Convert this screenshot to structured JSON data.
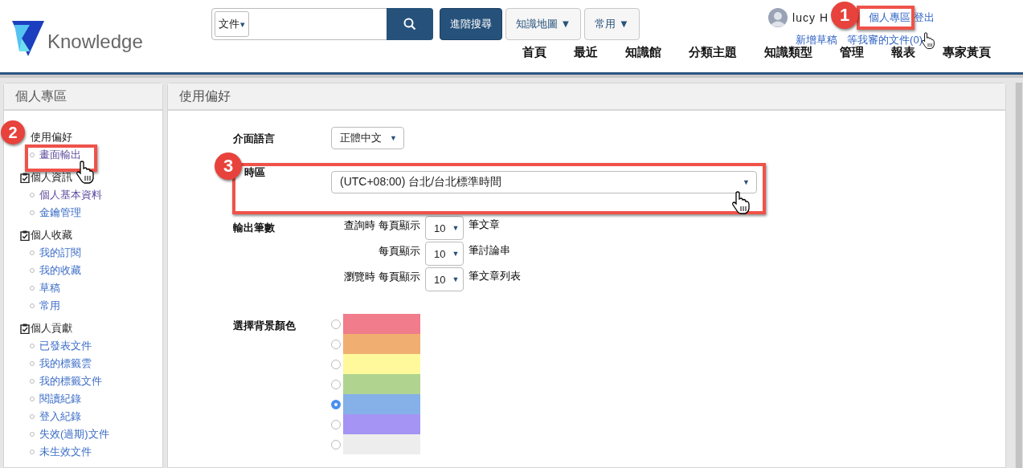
{
  "header": {
    "logo_text": "Knowledge",
    "search": {
      "scope": "文件",
      "scope_caret": "▾"
    },
    "buttons": [
      {
        "label": "進階搜尋",
        "kind": "primary"
      },
      {
        "label": "知識地圖",
        "caret": "▼",
        "kind": "dropdown"
      },
      {
        "label": "常用",
        "caret": "▼",
        "kind": "dropdown"
      }
    ],
    "user": {
      "name": "lucy H",
      "links": [
        "個人專區",
        "登出"
      ],
      "sublinks": [
        "新增草稿",
        "等我審的文件(0)"
      ]
    },
    "nav": [
      "首頁",
      "最近",
      "知識館",
      "分類主題",
      "知識類型",
      "管理",
      "報表",
      "專家黃頁"
    ]
  },
  "sidebar": {
    "title": "個人專區",
    "groups": [
      {
        "title": "使用偏好",
        "kind": "plain",
        "items": [
          {
            "label": "畫面輸出",
            "visited": true
          }
        ]
      },
      {
        "title": "個人資訊",
        "kind": "checklist",
        "items": [
          {
            "label": "個人基本資料",
            "visited": true
          },
          {
            "label": "金鑰管理",
            "visited": false
          }
        ]
      },
      {
        "title": "個人收藏",
        "kind": "checklist",
        "items": [
          {
            "label": "我的訂閱",
            "visited": false
          },
          {
            "label": "我的收藏",
            "visited": false
          },
          {
            "label": "草稿",
            "visited": false
          },
          {
            "label": "常用",
            "visited": false
          }
        ]
      },
      {
        "title": "個人貢獻",
        "kind": "checklist",
        "items": [
          {
            "label": "已發表文件",
            "visited": false
          },
          {
            "label": "我的標籤雲",
            "visited": false
          },
          {
            "label": "我的標籤文件",
            "visited": false
          },
          {
            "label": "閱讀紀錄",
            "visited": false
          },
          {
            "label": "登入紀錄",
            "visited": false
          },
          {
            "label": "失效(過期)文件",
            "visited": false
          },
          {
            "label": "未生效文件",
            "visited": false
          }
        ]
      }
    ]
  },
  "main": {
    "title": "使用偏好",
    "language": {
      "label": "介面語言",
      "value": "正體中文",
      "caret": "▼"
    },
    "timezone": {
      "label": "時區",
      "value": "(UTC+08:00) 台北/台北標準時間",
      "caret": "▼"
    },
    "output": {
      "label": "輸出筆數",
      "rows": [
        {
          "prefix": "查詢時 每頁顯示",
          "value": "10",
          "caret": "▼",
          "suffix": "筆文章"
        },
        {
          "prefix": "每頁顯示",
          "value": "10",
          "caret": "▼",
          "suffix": "筆討論串"
        },
        {
          "prefix": "瀏覽時 每頁顯示",
          "value": "10",
          "caret": "▼",
          "suffix": "筆文章列表"
        }
      ]
    },
    "background": {
      "label": "選擇背景顏色",
      "options": [
        {
          "color": "#f07c8c",
          "selected": false
        },
        {
          "color": "#f0af70",
          "selected": false
        },
        {
          "color": "#fff99c",
          "selected": false
        },
        {
          "color": "#b0d490",
          "selected": false
        },
        {
          "color": "#85b0e8",
          "selected": true
        },
        {
          "color": "#a594f4",
          "selected": false
        },
        {
          "color": "#ededed",
          "selected": false
        }
      ]
    }
  },
  "annotations": [
    {
      "number": "1"
    },
    {
      "number": "2"
    },
    {
      "number": "3"
    }
  ]
}
